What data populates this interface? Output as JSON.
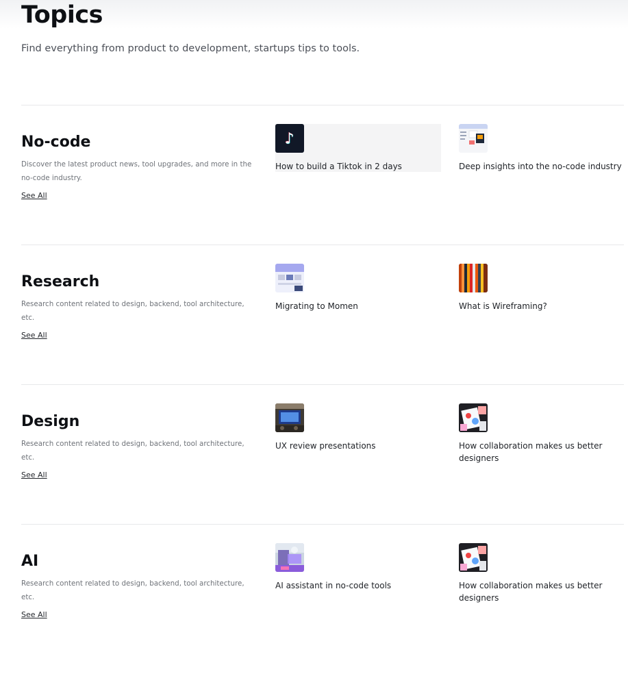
{
  "header": {
    "title": "Topics",
    "subtitle": "Find everything from product to development, startups tips to tools."
  },
  "sections": [
    {
      "title": "No-code",
      "description": "Discover the latest product news, tool upgrades, and more in the no-code industry.",
      "see_all": "See All",
      "cards": [
        {
          "title": "How to build a Tiktok in 2 days",
          "icon": "tiktok-icon"
        },
        {
          "title": "Deep insights into the no-code industry",
          "icon": "dashboard-thumbnail"
        }
      ]
    },
    {
      "title": "Research",
      "description": "Research content related to design, backend, tool architecture, etc.",
      "see_all": "See All",
      "cards": [
        {
          "title": "Migrating to Momen",
          "icon": "ui-thumbnail"
        },
        {
          "title": "What is Wireframing?",
          "icon": "color-swatches-thumbnail"
        }
      ]
    },
    {
      "title": "Design",
      "description": "Research content related to design, backend, tool architecture, etc.",
      "see_all": "See All",
      "cards": [
        {
          "title": "UX review presentations",
          "icon": "presentation-thumbnail"
        },
        {
          "title": "How collaboration makes us better designers",
          "icon": "collaboration-thumbnail"
        }
      ]
    },
    {
      "title": "AI",
      "description": "Research content related to design, backend, tool architecture, etc.",
      "see_all": "See All",
      "cards": [
        {
          "title": "AI assistant in no-code tools",
          "icon": "ai-assistant-thumbnail"
        },
        {
          "title": "How collaboration makes us better designers",
          "icon": "collaboration-thumbnail"
        }
      ]
    }
  ]
}
